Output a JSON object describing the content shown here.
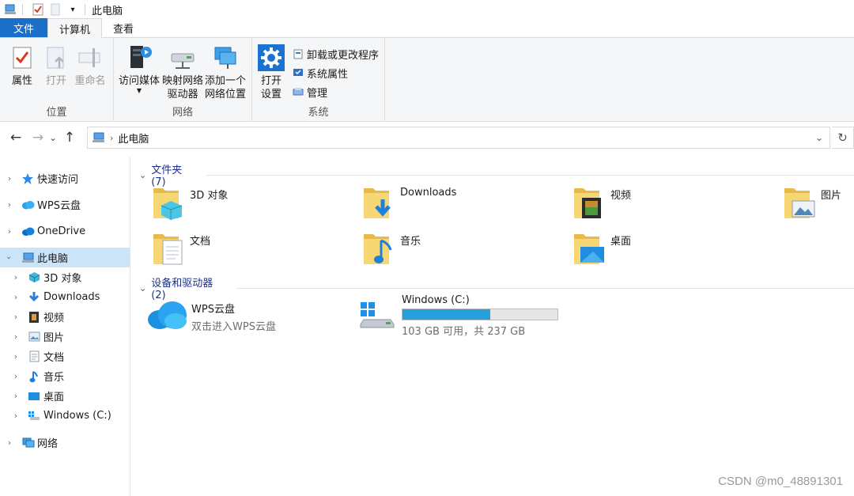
{
  "window": {
    "title": "此电脑"
  },
  "tabs": [
    {
      "label": "文件"
    },
    {
      "label": "计算机"
    },
    {
      "label": "查看"
    }
  ],
  "ribbon": {
    "location_group": {
      "label": "位置",
      "properties": "属性",
      "open": "打开",
      "rename": "重命名"
    },
    "network_group": {
      "label": "网络",
      "access_media": "访问媒体",
      "map_drive_1": "映射网络",
      "map_drive_2": "驱动器",
      "add_location_1": "添加一个",
      "add_location_2": "网络位置"
    },
    "system_group": {
      "label": "系统",
      "open_settings_1": "打开",
      "open_settings_2": "设置",
      "uninstall": "卸载或更改程序",
      "system_properties": "系统属性",
      "manage": "管理"
    }
  },
  "address": {
    "path": "此电脑"
  },
  "navpane": {
    "items": [
      {
        "label": "快速访问"
      },
      {
        "label": "WPS云盘"
      },
      {
        "label": "OneDrive"
      },
      {
        "label": "此电脑"
      },
      {
        "label": "3D 对象"
      },
      {
        "label": "Downloads"
      },
      {
        "label": "视频"
      },
      {
        "label": "图片"
      },
      {
        "label": "文档"
      },
      {
        "label": "音乐"
      },
      {
        "label": "桌面"
      },
      {
        "label": "Windows (C:)"
      },
      {
        "label": "网络"
      }
    ]
  },
  "content": {
    "folders_header": "文件夹 (7)",
    "folders": [
      {
        "name": "3D 对象"
      },
      {
        "name": "Downloads"
      },
      {
        "name": "视频"
      },
      {
        "name": "图片"
      },
      {
        "name": "文档"
      },
      {
        "name": "音乐"
      },
      {
        "name": "桌面"
      }
    ],
    "devices_header": "设备和驱动器 (2)",
    "devices": [
      {
        "name": "WPS云盘",
        "subtitle": "双击进入WPS云盘"
      },
      {
        "name": "Windows (C:)",
        "subtitle": "103 GB 可用，共 237 GB",
        "used_fraction": 0.565
      }
    ]
  },
  "watermark": "CSDN @m0_48891301"
}
